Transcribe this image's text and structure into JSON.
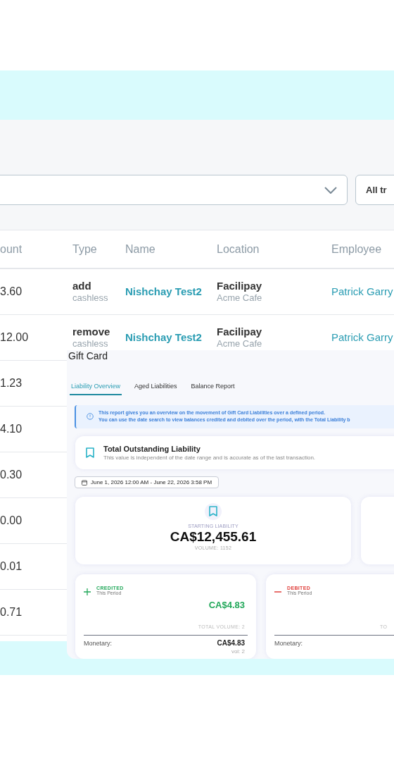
{
  "filter": {
    "button": "All tr"
  },
  "table": {
    "columns": [
      "ount",
      "Type",
      "Name",
      "Location",
      "Employee"
    ],
    "rows": [
      {
        "amount": "3.60",
        "type": "add",
        "type_sub": "cashless",
        "name": "Nishchay Test2",
        "location": "Facilipay",
        "location_sub": "Acme Cafe",
        "employee": "Patrick Garry"
      },
      {
        "amount": "12.00",
        "type": "remove",
        "type_sub": "cashless",
        "name": "Nishchay Test2",
        "location": "Facilipay",
        "location_sub": "Acme Cafe",
        "employee": "Patrick Garry"
      },
      {
        "amount": "1.23"
      },
      {
        "amount": "4.10"
      },
      {
        "amount": "0.30"
      },
      {
        "amount": "0.00"
      },
      {
        "amount": "0.01"
      },
      {
        "amount": "0.71"
      }
    ]
  },
  "panel": {
    "title": "Gift Card",
    "tabs": [
      {
        "label": "Liability Overview",
        "selected": true
      },
      {
        "label": "Aged Liabilities",
        "selected": false
      },
      {
        "label": "Balance Report",
        "selected": false
      }
    ],
    "info": [
      "This report gives you an overview on the movement of Gift Card Liabilities over a defined period.",
      "You can use the date search to view balances credited and debited over the period, with the Total Liability b"
    ],
    "total": {
      "title": "Total Outstanding Liability",
      "subtitle": "This value is independent of the date range and is accurate as of the last transaction."
    },
    "date_range": "June 1, 2026 12:00 AM - June 22, 2026 3:58 PM",
    "starting": {
      "label": "STARTING LIABILITY",
      "value": "CA$12,455.61",
      "volume": "VOLUME: 1152"
    },
    "movements": [
      {
        "kind": "credit",
        "label": "CREDITED",
        "period": "This Period",
        "value": "CA$4.83",
        "volume": "TOTAL VOLUME: 2",
        "line_label": "Monetary:",
        "line_value": "CA$4.83",
        "line_vol": "vol: 2"
      },
      {
        "kind": "debit",
        "label": "DEBITED",
        "period": "This Period",
        "volume": "TO",
        "line_label": "Monetary:"
      }
    ]
  }
}
